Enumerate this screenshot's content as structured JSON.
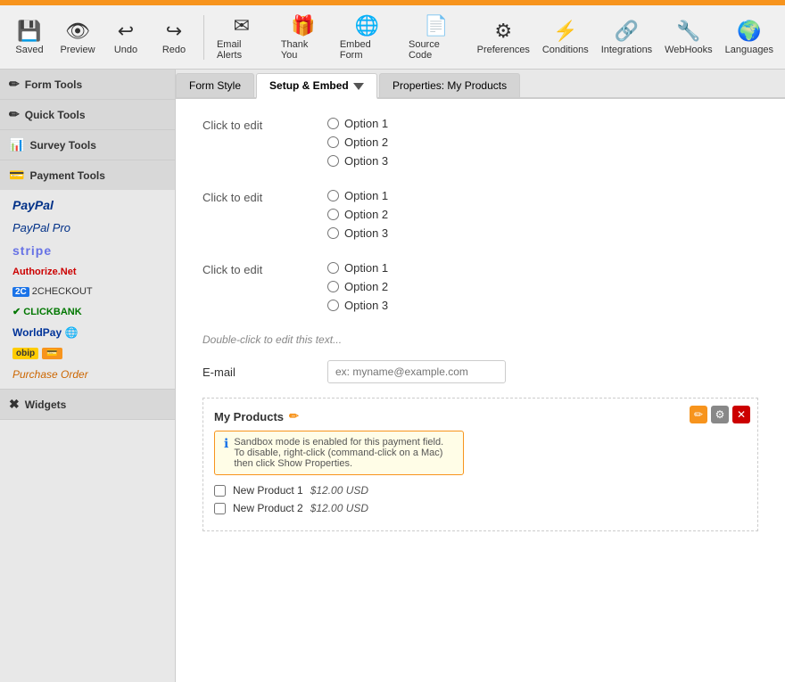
{
  "topbar": {},
  "toolbar": {
    "items": [
      {
        "id": "saved",
        "icon": "💾",
        "label": "Saved"
      },
      {
        "id": "preview",
        "icon": "👁",
        "label": "Preview"
      },
      {
        "id": "undo",
        "icon": "↩",
        "label": "Undo"
      },
      {
        "id": "redo",
        "icon": "↪",
        "label": "Redo"
      },
      {
        "id": "email-alerts",
        "icon": "✉",
        "label": "Email Alerts"
      },
      {
        "id": "thank-you",
        "icon": "🎁",
        "label": "Thank You"
      },
      {
        "id": "embed-form",
        "icon": "🌐",
        "label": "Embed Form"
      },
      {
        "id": "source-code",
        "icon": "📄",
        "label": "Source Code"
      },
      {
        "id": "preferences",
        "icon": "⚙",
        "label": "Preferences"
      },
      {
        "id": "conditions",
        "icon": "⚡",
        "label": "Conditions"
      },
      {
        "id": "integrations",
        "icon": "🔗",
        "label": "Integrations"
      },
      {
        "id": "webhooks",
        "icon": "🔧",
        "label": "WebHooks"
      },
      {
        "id": "languages",
        "icon": "🌍",
        "label": "Languages"
      }
    ]
  },
  "sidebar": {
    "sections": [
      {
        "id": "form-tools",
        "label": "Form Tools",
        "icon": "✏"
      },
      {
        "id": "quick-tools",
        "label": "Quick Tools",
        "icon": "✏"
      },
      {
        "id": "survey-tools",
        "label": "Survey Tools",
        "icon": "📊"
      },
      {
        "id": "payment-tools",
        "label": "Payment Tools",
        "icon": "💳",
        "items": [
          {
            "id": "paypal",
            "label": "PayPal",
            "class": "paypal"
          },
          {
            "id": "paypal-pro",
            "label": "PayPal Pro",
            "class": "paypal-pro"
          },
          {
            "id": "stripe",
            "label": "stripe",
            "class": "stripe"
          },
          {
            "id": "authorize",
            "label": "Authorize.Net",
            "class": "authorize"
          },
          {
            "id": "2checkout",
            "label": "2CHECKOUT",
            "class": "twocheckout"
          },
          {
            "id": "clickbank",
            "label": "✔ CLICKBANK",
            "class": "clickbank"
          },
          {
            "id": "worldpay",
            "label": "WorldPay 🌐",
            "class": "worldpay"
          },
          {
            "id": "obip",
            "label": "obip 💳",
            "class": "obip"
          },
          {
            "id": "purchase",
            "label": "Purchase Order",
            "class": "purchase"
          }
        ]
      },
      {
        "id": "widgets",
        "label": "Widgets",
        "icon": "✖"
      }
    ]
  },
  "tabs": [
    {
      "id": "form-style",
      "label": "Form Style"
    },
    {
      "id": "setup-embed",
      "label": "Setup & Embed",
      "active": true
    },
    {
      "id": "properties",
      "label": "Properties: My Products"
    }
  ],
  "form": {
    "fieldGroups": [
      {
        "id": "group1",
        "label": "Click to edit",
        "options": [
          "Option 1",
          "Option 2",
          "Option 3"
        ]
      },
      {
        "id": "group2",
        "label": "Click to edit",
        "options": [
          "Option 1",
          "Option 2",
          "Option 3"
        ]
      },
      {
        "id": "group3",
        "label": "Click to edit",
        "options": [
          "Option 1",
          "Option 2",
          "Option 3"
        ]
      }
    ],
    "doubleClickText": "Double-click to edit this text...",
    "emailLabel": "E-mail",
    "emailPlaceholder": "ex: myname@example.com",
    "paymentWidget": {
      "title": "My Products",
      "sandboxNotice": "Sandbox mode is enabled for this payment field. To disable, right-click (command-click on a Mac) then click Show Properties.",
      "products": [
        {
          "id": "product1",
          "label": "New Product 1",
          "price": "$12.00 USD"
        },
        {
          "id": "product2",
          "label": "New Product 2",
          "price": "$12.00 USD"
        }
      ]
    }
  }
}
